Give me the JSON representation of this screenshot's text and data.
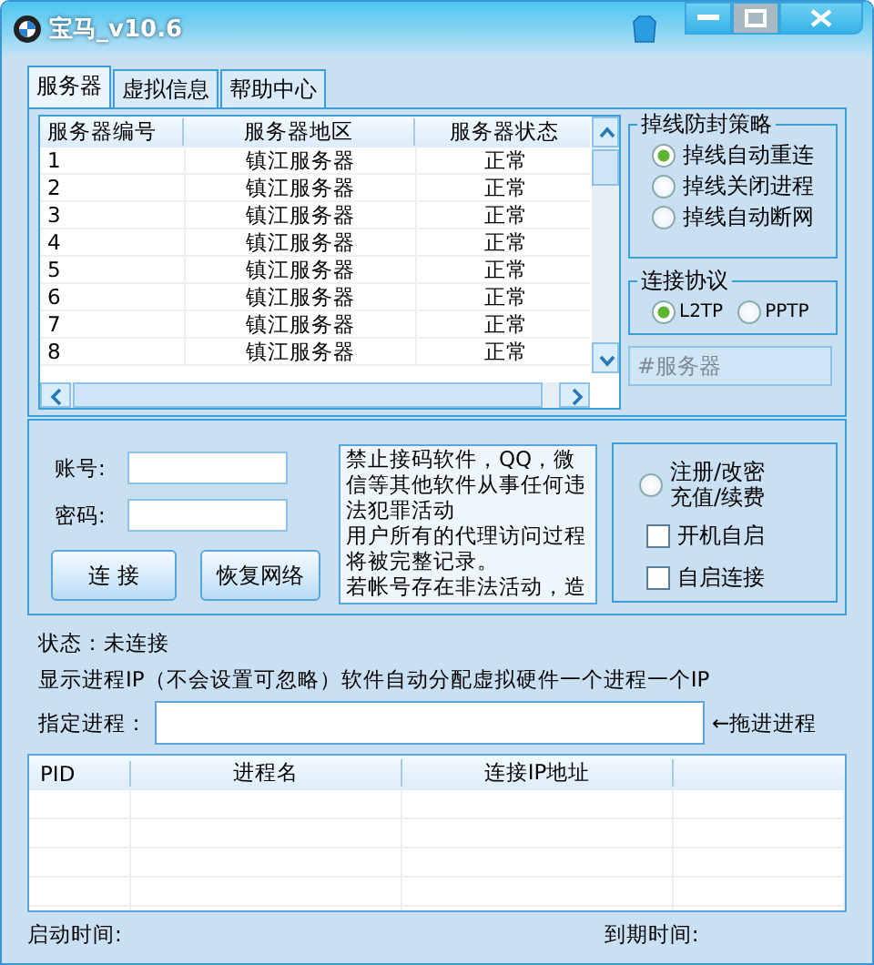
{
  "window": {
    "title": "宝马_v10.6"
  },
  "tabs": [
    {
      "label": "服务器",
      "selected": true
    },
    {
      "label": "虚拟信息",
      "selected": false
    },
    {
      "label": "帮助中心",
      "selected": false
    }
  ],
  "server_table": {
    "columns": [
      "服务器编号",
      "服务器地区",
      "服务器状态"
    ],
    "rows": [
      {
        "id": "1",
        "region": "镇江服务器",
        "status": "正常"
      },
      {
        "id": "2",
        "region": "镇江服务器",
        "status": "正常"
      },
      {
        "id": "3",
        "region": "镇江服务器",
        "status": "正常"
      },
      {
        "id": "4",
        "region": "镇江服务器",
        "status": "正常"
      },
      {
        "id": "5",
        "region": "镇江服务器",
        "status": "正常"
      },
      {
        "id": "6",
        "region": "镇江服务器",
        "status": "正常"
      },
      {
        "id": "7",
        "region": "镇江服务器",
        "status": "正常"
      },
      {
        "id": "8",
        "region": "镇江服务器",
        "status": "正常"
      }
    ]
  },
  "anti_ban": {
    "title": "掉线防封策略",
    "options": [
      {
        "label": "掉线自动重连",
        "selected": true
      },
      {
        "label": "掉线关闭进程",
        "selected": false
      },
      {
        "label": "掉线自动断网",
        "selected": false
      }
    ]
  },
  "protocol": {
    "title": "连接协议",
    "options": [
      {
        "label": "L2TP",
        "selected": true
      },
      {
        "label": "PPTP",
        "selected": false
      }
    ]
  },
  "server_field": {
    "placeholder": "#服务器"
  },
  "login": {
    "account_label": "账号:",
    "password_label": "密码:",
    "connect_button": "连 接",
    "restore_button": "恢复网络"
  },
  "notice": [
    "禁止接码软件，QQ，微信等其他软件从事任何违法犯罪活动",
    "用户所有的代理访问过程将被完整记录。",
    "若帐号存在非法活动，造"
  ],
  "account_options": {
    "register": {
      "lines": [
        "注册/改密",
        "充值/续费"
      ],
      "selected": false
    },
    "checkboxes": [
      {
        "label": "开机自启",
        "checked": false
      },
      {
        "label": "自启连接",
        "checked": false
      }
    ]
  },
  "status": "状态：未连接",
  "hint": "显示进程IP（不会设置可忽略）软件自动分配虚拟硬件一个进程一个IP",
  "process_field": {
    "label": "指定进程：",
    "drag_hint": "←拖进进程"
  },
  "process_table": {
    "columns": [
      "PID",
      "进程名",
      "连接IP地址"
    ]
  },
  "footer": {
    "start_label": "启动时间:",
    "expire_label": "到期时间:"
  }
}
